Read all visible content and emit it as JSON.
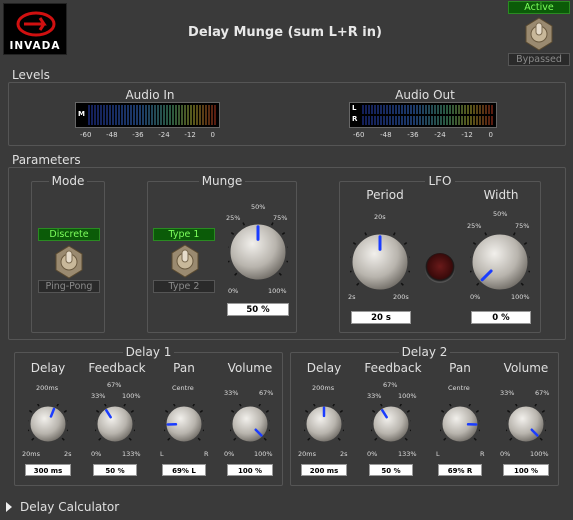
{
  "logo": {
    "text": "INVADA"
  },
  "header": {
    "title": "Delay Munge (sum L+R in)",
    "active_label": "Active",
    "bypassed_label": "Bypassed"
  },
  "levels": {
    "section_label": "Levels",
    "audio_in": {
      "label": "Audio In",
      "channels": [
        "M"
      ],
      "scale": [
        "-60",
        "-48",
        "-36",
        "-24",
        "-12",
        "0"
      ]
    },
    "audio_out": {
      "label": "Audio Out",
      "channels": [
        "L",
        "R"
      ],
      "scale": [
        "-60",
        "-48",
        "-36",
        "-24",
        "-12",
        "0"
      ]
    }
  },
  "parameters": {
    "section_label": "Parameters",
    "mode": {
      "label": "Mode",
      "on": "Discrete",
      "off": "Ping-Pong"
    },
    "munge": {
      "label": "Munge",
      "on": "Type 1",
      "off": "Type 2",
      "value": "50 %",
      "ticks": {
        "min": "0%",
        "q1": "25%",
        "mid": "50%",
        "q3": "75%",
        "max": "100%"
      },
      "level": 0.5
    },
    "lfo": {
      "label": "LFO",
      "period": {
        "label": "Period",
        "value": "20 s",
        "ticks": {
          "min": "2s",
          "mid": "20s",
          "max": "200s"
        },
        "level": 0.5
      },
      "width": {
        "label": "Width",
        "value": "0 %",
        "ticks": {
          "min": "0%",
          "q1": "25%",
          "mid": "50%",
          "q3": "75%",
          "max": "100%"
        },
        "level": 0.0
      }
    }
  },
  "delay1": {
    "label": "Delay 1",
    "delay": {
      "label": "Delay",
      "value": "300 ms",
      "ticks": {
        "min": "20ms",
        "mid": "200ms",
        "max": "2s"
      },
      "level": 0.58
    },
    "feedback": {
      "label": "Feedback",
      "value": "50 %",
      "ticks": {
        "min": "0%",
        "q1": "33%",
        "mid": "67%",
        "q3": "100%",
        "max": "133%"
      },
      "level": 0.38
    },
    "pan": {
      "label": "Pan",
      "value": "69% L",
      "ticks": {
        "min": "L",
        "mid": "Centre",
        "max": "R"
      },
      "level": 0.16
    },
    "volume": {
      "label": "Volume",
      "value": "100 %",
      "ticks": {
        "min": "0%",
        "q1": "33%",
        "q3": "67%",
        "max": "100%"
      },
      "level": 1.0
    }
  },
  "delay2": {
    "label": "Delay 2",
    "delay": {
      "label": "Delay",
      "value": "200 ms",
      "ticks": {
        "min": "20ms",
        "mid": "200ms",
        "max": "2s"
      },
      "level": 0.5
    },
    "feedback": {
      "label": "Feedback",
      "value": "50 %",
      "ticks": {
        "min": "0%",
        "q1": "33%",
        "mid": "67%",
        "q3": "100%",
        "max": "133%"
      },
      "level": 0.38
    },
    "pan": {
      "label": "Pan",
      "value": "69% R",
      "ticks": {
        "min": "L",
        "mid": "Centre",
        "max": "R"
      },
      "level": 0.84
    },
    "volume": {
      "label": "Volume",
      "value": "100 %",
      "ticks": {
        "min": "0%",
        "q1": "33%",
        "q3": "67%",
        "max": "100%"
      },
      "level": 1.0
    }
  },
  "footer": {
    "expander_label": "Delay Calculator"
  },
  "colors": {
    "accent": "#1a3cff",
    "led_on": "#7cff5c",
    "led_bg": "#0b5b08",
    "logo_red": "#d01010"
  }
}
